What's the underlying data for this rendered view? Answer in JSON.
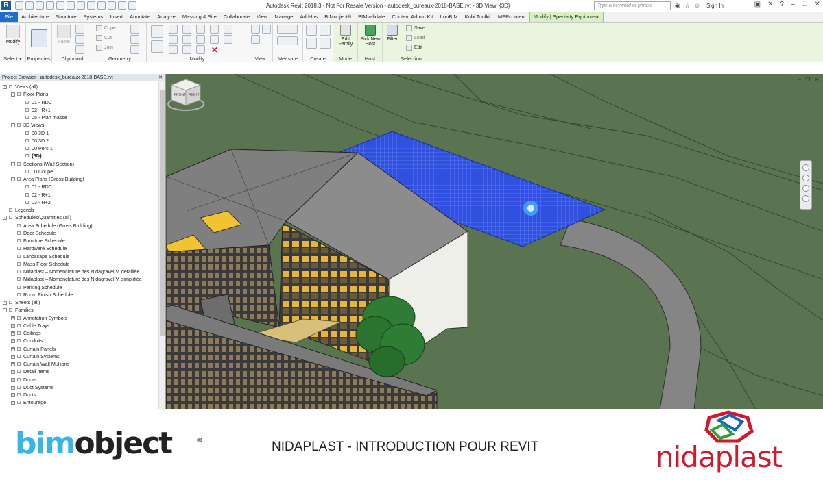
{
  "titlebar": {
    "app_icon": "R",
    "title": "Autodesk Revit 2018.3 -  Not For Resale Version -    autodesk_bureaux-2018-BASE.rvt - 3D View: {3D}",
    "search_placeholder": "Type a keyword or phrase",
    "signin": "Sign In",
    "icons": [
      "binoculars-icon",
      "star-icon",
      "user-icon",
      "cart-icon",
      "exchange-icon",
      "help-icon"
    ]
  },
  "tabs": [
    {
      "label": "File"
    },
    {
      "label": "Architecture"
    },
    {
      "label": "Structure"
    },
    {
      "label": "Systems"
    },
    {
      "label": "Insert"
    },
    {
      "label": "Annotate"
    },
    {
      "label": "Analyze"
    },
    {
      "label": "Massing & Site"
    },
    {
      "label": "Collaborate"
    },
    {
      "label": "View"
    },
    {
      "label": "Manage"
    },
    {
      "label": "Add-Ins"
    },
    {
      "label": "BIMobject®"
    },
    {
      "label": "BIMvalidate"
    },
    {
      "label": "Content Admin Kit"
    },
    {
      "label": "IronBIM"
    },
    {
      "label": "Kobi Toolkit"
    },
    {
      "label": "MEPcontent"
    },
    {
      "label": "Modify | Specialty Equipment"
    }
  ],
  "ribbon": {
    "modify_label": "Modify",
    "select_label": "Select",
    "properties_label": "Properties",
    "paste_label": "Paste",
    "clipboard_label": "Clipboard",
    "cope_label": "Cope",
    "cut_label": "Cut",
    "join_label": "Join",
    "geometry_label": "Geometry",
    "modify_panel_label": "Modify",
    "view_label": "View",
    "measure_label": "Measure",
    "create_label": "Create",
    "edit_family_label": "Edit Family",
    "mode_label": "Mode",
    "pick_host_label": "Pick New Host",
    "host_label": "Host",
    "filter_label": "Filter",
    "save_label": "Save",
    "load_label": "Load",
    "edit_label": "Edit",
    "selection_label": "Selection"
  },
  "browser": {
    "title": "Project Browser - autodesk_bureaux-2018-BASE.rvt",
    "nodes": [
      {
        "text": "Views (all)",
        "level": 0,
        "toggle": "-"
      },
      {
        "text": "Floor Plans",
        "level": 1,
        "toggle": "-"
      },
      {
        "text": "01 - RDC",
        "level": 2,
        "toggle": ""
      },
      {
        "text": "02 - R+1",
        "level": 2,
        "toggle": ""
      },
      {
        "text": "05 - Plan masse",
        "level": 2,
        "toggle": ""
      },
      {
        "text": "3D Views",
        "level": 1,
        "toggle": "-"
      },
      {
        "text": "00 3D 1",
        "level": 2,
        "toggle": ""
      },
      {
        "text": "00 3D 2",
        "level": 2,
        "toggle": ""
      },
      {
        "text": "00 Pers 1",
        "level": 2,
        "toggle": ""
      },
      {
        "text": "{3D}",
        "level": 2,
        "toggle": "",
        "bold": true
      },
      {
        "text": "Sections (Wall Section)",
        "level": 1,
        "toggle": "-"
      },
      {
        "text": "00 Coupe",
        "level": 2,
        "toggle": ""
      },
      {
        "text": "Area Plans (Gross Building)",
        "level": 1,
        "toggle": "-"
      },
      {
        "text": "01 - RDC",
        "level": 2,
        "toggle": ""
      },
      {
        "text": "02 - R+1",
        "level": 2,
        "toggle": ""
      },
      {
        "text": "03 - R+2",
        "level": 2,
        "toggle": ""
      },
      {
        "text": "Legends",
        "level": 0,
        "toggle": ""
      },
      {
        "text": "Schedules/Quantities (all)",
        "level": 0,
        "toggle": "-"
      },
      {
        "text": "Area Schedule (Gross Building)",
        "level": 1,
        "toggle": ""
      },
      {
        "text": "Door Schedule",
        "level": 1,
        "toggle": ""
      },
      {
        "text": "Furniture Schedule",
        "level": 1,
        "toggle": ""
      },
      {
        "text": "Hardware Schedule",
        "level": 1,
        "toggle": ""
      },
      {
        "text": "Landscape Schedule",
        "level": 1,
        "toggle": ""
      },
      {
        "text": "Mass Floor Schedule",
        "level": 1,
        "toggle": ""
      },
      {
        "text": "Nidaplast – Nomenclature des Nidagravel V. détaillée",
        "level": 1,
        "toggle": ""
      },
      {
        "text": "Nidaplast – Nomenclature des Nidagravel V. simplifiée",
        "level": 1,
        "toggle": ""
      },
      {
        "text": "Parking Schedule",
        "level": 1,
        "toggle": ""
      },
      {
        "text": "Room Finish Schedule",
        "level": 1,
        "toggle": ""
      },
      {
        "text": "Sheets (all)",
        "level": 0,
        "toggle": "+"
      },
      {
        "text": "Families",
        "level": 0,
        "toggle": "-"
      },
      {
        "text": "Annotation Symbols",
        "level": 1,
        "toggle": "+"
      },
      {
        "text": "Cable Trays",
        "level": 1,
        "toggle": "+"
      },
      {
        "text": "Ceilings",
        "level": 1,
        "toggle": "+"
      },
      {
        "text": "Conduits",
        "level": 1,
        "toggle": "+"
      },
      {
        "text": "Curtain Panels",
        "level": 1,
        "toggle": "+"
      },
      {
        "text": "Curtain Systems",
        "level": 1,
        "toggle": "+"
      },
      {
        "text": "Curtain Wall Mullions",
        "level": 1,
        "toggle": "+"
      },
      {
        "text": "Detail Items",
        "level": 1,
        "toggle": "+"
      },
      {
        "text": "Doors",
        "level": 1,
        "toggle": "+"
      },
      {
        "text": "Duct Systems",
        "level": 1,
        "toggle": "+"
      },
      {
        "text": "Ducts",
        "level": 1,
        "toggle": "+"
      },
      {
        "text": "Entourage",
        "level": 1,
        "toggle": "+"
      }
    ]
  },
  "viewport": {
    "view_name": "{3D}",
    "viewcube_front": "FRONT",
    "viewcube_right": "RIGHT"
  },
  "footer": {
    "bim_part1": "bim",
    "bim_part2": "object",
    "bim_reg": "®",
    "video_title": "NIDAPLAST - INTRODUCTION POUR REVIT",
    "nidaplast_word": "nidaplast"
  },
  "colors": {
    "terrain": "#5a7351",
    "nidaplast_panel": "#2f4ee0",
    "file_tab": "#1e6fc9",
    "contextual_tab": "#d8f0c4",
    "nidaplast_red": "#d1182d",
    "bim_blue": "#35b5e8"
  }
}
